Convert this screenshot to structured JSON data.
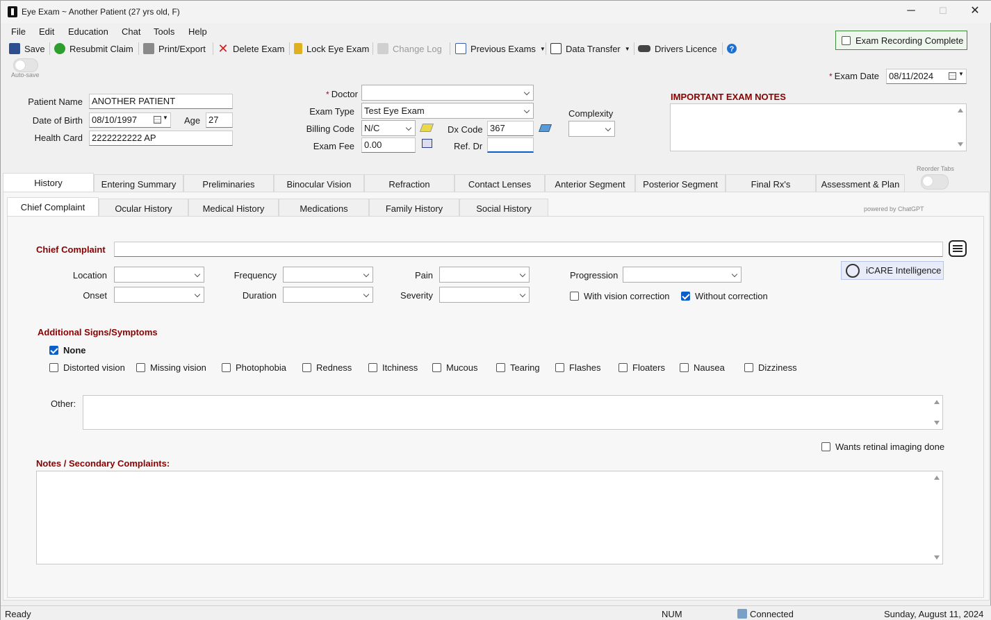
{
  "window": {
    "title": "Eye Exam ~ Another Patient (27 yrs old, F)",
    "minimize": "─",
    "maximize": "☐",
    "close": "✕"
  },
  "menu": [
    "File",
    "Edit",
    "Education",
    "Chat",
    "Tools",
    "Help"
  ],
  "toolbar": {
    "save": "Save",
    "resubmit": "Resubmit Claim",
    "print": "Print/Export",
    "delete": "Delete Exam",
    "lock": "Lock Eye Exam",
    "changelog": "Change Log",
    "previous": "Previous Exams",
    "transfer": "Data Transfer",
    "licence": "Drivers Licence",
    "help_icon": "?"
  },
  "autosave": {
    "label": "Auto-save"
  },
  "exam_complete": {
    "label": "Exam Recording Complete",
    "checked": false
  },
  "exam_date": {
    "label": "Exam Date",
    "value": "08/11/2024"
  },
  "patient": {
    "name_label": "Patient Name",
    "name_value": "ANOTHER PATIENT",
    "dob_label": "Date of Birth",
    "dob_value": "08/10/1997",
    "age_label": "Age",
    "age_value": "27",
    "hc_label": "Health Card",
    "hc_value": "2222222222 AP"
  },
  "exam": {
    "doctor_label": "Doctor",
    "doctor_value": "",
    "type_label": "Exam Type",
    "type_value": "Test Eye Exam",
    "billing_label": "Billing Code",
    "billing_value": "N/C",
    "dx_label": "Dx Code",
    "dx_value": "367",
    "fee_label": "Exam Fee",
    "fee_value": "0.00",
    "refdr_label": "Ref. Dr",
    "refdr_value": "",
    "complexity_label": "Complexity",
    "complexity_value": ""
  },
  "notes_header": "IMPORTANT EXAM NOTES",
  "reorder_tabs": "Reorder Tabs",
  "main_tabs": [
    "History",
    "Entering Summary",
    "Preliminaries",
    "Binocular Vision",
    "Refraction",
    "Contact Lenses",
    "Anterior Segment",
    "Posterior Segment",
    "Final Rx's",
    "Assessment & Plan"
  ],
  "sub_tabs": [
    "Chief Complaint",
    "Ocular History",
    "Medical History",
    "Medications",
    "Family History",
    "Social History"
  ],
  "powered_by": "powered by ChatGPT",
  "chief_complaint": {
    "label": "Chief Complaint",
    "value": "",
    "icare": "iCARE Intelligence",
    "location": "Location",
    "onset": "Onset",
    "frequency": "Frequency",
    "duration": "Duration",
    "pain": "Pain",
    "severity": "Severity",
    "progression": "Progression",
    "with_correction": "With vision correction",
    "without_correction": "Without correction"
  },
  "signs": {
    "header": "Additional Signs/Symptoms",
    "none": "None",
    "items": [
      "Distorted vision",
      "Missing vision",
      "Photophobia",
      "Redness",
      "Itchiness",
      "Mucous",
      "Tearing",
      "Flashes",
      "Floaters",
      "Nausea",
      "Dizziness"
    ],
    "other_label": "Other:"
  },
  "retinal": "Wants retinal imaging done",
  "notes_secondary": "Notes / Secondary Complaints:",
  "status": {
    "ready": "Ready",
    "num": "NUM",
    "connected": "Connected",
    "date": "Sunday, August 11, 2024"
  },
  "colors": {
    "accent": "#8b0000",
    "check": "#0a5ecc",
    "complete_border": "#3c8a3c"
  }
}
